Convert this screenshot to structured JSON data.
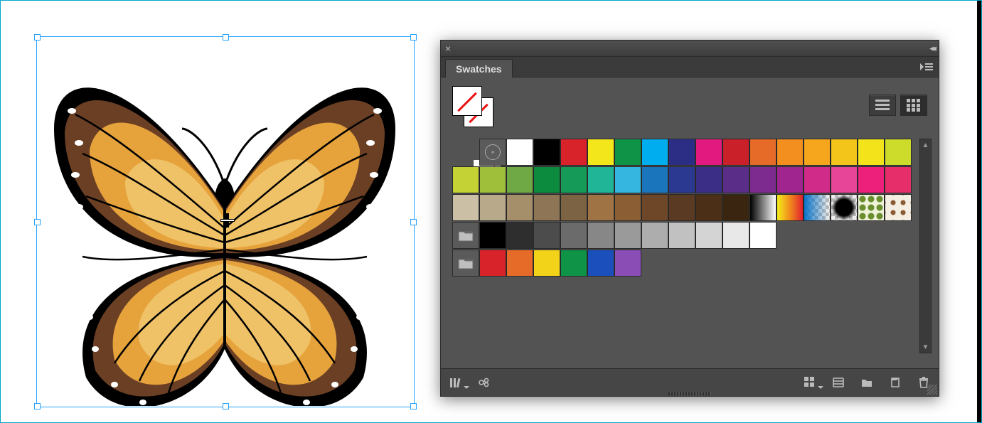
{
  "panel": {
    "tab_label": "Swatches",
    "fillstroke": {
      "fill": "none",
      "stroke": "none"
    },
    "view_buttons": {
      "list": "list-view",
      "grid": "grid-view",
      "active": "grid"
    },
    "rows": [
      {
        "type": "colors",
        "selected_index": 0,
        "cells": [
          {
            "kind": "none",
            "name": "none-swatch"
          },
          {
            "kind": "reg",
            "name": "registration-swatch"
          },
          {
            "kind": "color",
            "name": "white",
            "value": "#ffffff"
          },
          {
            "kind": "color",
            "name": "black",
            "value": "#000000"
          },
          {
            "kind": "color",
            "name": "cmyk-red",
            "value": "#d9232a"
          },
          {
            "kind": "color",
            "name": "cmyk-yellow",
            "value": "#f3e71b"
          },
          {
            "kind": "color",
            "name": "cmyk-green",
            "value": "#0f9347"
          },
          {
            "kind": "color",
            "name": "cmyk-cyan",
            "value": "#00adef"
          },
          {
            "kind": "color",
            "name": "cmyk-blue",
            "value": "#2c2e85"
          },
          {
            "kind": "color",
            "name": "cmyk-magenta",
            "value": "#e2197e"
          },
          {
            "kind": "color",
            "name": "red-2",
            "value": "#c9202a"
          },
          {
            "kind": "color",
            "name": "orange-1",
            "value": "#e76b28"
          },
          {
            "kind": "color",
            "name": "orange-2",
            "value": "#f28f1e"
          },
          {
            "kind": "color",
            "name": "amber",
            "value": "#f6a61c"
          },
          {
            "kind": "color",
            "name": "gold",
            "value": "#f3c41a"
          },
          {
            "kind": "color",
            "name": "yellow-2",
            "value": "#f2e31a"
          },
          {
            "kind": "color",
            "name": "lime-2",
            "value": "#cddc2a"
          }
        ]
      },
      {
        "type": "colors",
        "cells": [
          {
            "kind": "color",
            "name": "lime-3",
            "value": "#c4d235"
          },
          {
            "kind": "color",
            "name": "olive-1",
            "value": "#9fbf3a"
          },
          {
            "kind": "color",
            "name": "leaf",
            "value": "#6fa945"
          },
          {
            "kind": "color",
            "name": "green-2",
            "value": "#0c8b3f"
          },
          {
            "kind": "color",
            "name": "green-3",
            "value": "#169a58"
          },
          {
            "kind": "color",
            "name": "teal-1",
            "value": "#21b597"
          },
          {
            "kind": "color",
            "name": "sky-1",
            "value": "#35b6e0"
          },
          {
            "kind": "color",
            "name": "blue-2",
            "value": "#1b75bc"
          },
          {
            "kind": "color",
            "name": "blue-3",
            "value": "#2b3990"
          },
          {
            "kind": "color",
            "name": "indigo",
            "value": "#3a2e86"
          },
          {
            "kind": "color",
            "name": "violet",
            "value": "#5a2d88"
          },
          {
            "kind": "color",
            "name": "purple",
            "value": "#7d2b8e"
          },
          {
            "kind": "color",
            "name": "magenta-2",
            "value": "#a1258e"
          },
          {
            "kind": "color",
            "name": "fuchsia",
            "value": "#d12b8a"
          },
          {
            "kind": "color",
            "name": "pink",
            "value": "#e64598"
          },
          {
            "kind": "color",
            "name": "hot-pink",
            "value": "#ed207b"
          },
          {
            "kind": "color",
            "name": "rose",
            "value": "#e62e6b"
          }
        ]
      },
      {
        "type": "colors",
        "cells": [
          {
            "kind": "color",
            "name": "warm-gray-1",
            "value": "#cbbfa6"
          },
          {
            "kind": "color",
            "name": "warm-gray-2",
            "value": "#b8a98a"
          },
          {
            "kind": "color",
            "name": "tan-1",
            "value": "#a48f6a"
          },
          {
            "kind": "color",
            "name": "tan-2",
            "value": "#8d7556"
          },
          {
            "kind": "color",
            "name": "brown-1",
            "value": "#7b6344"
          },
          {
            "kind": "color",
            "name": "brown-2",
            "value": "#a07345"
          },
          {
            "kind": "color",
            "name": "brown-3",
            "value": "#8b5e34"
          },
          {
            "kind": "color",
            "name": "brown-4",
            "value": "#6d4728"
          },
          {
            "kind": "color",
            "name": "sienna",
            "value": "#5a3a22"
          },
          {
            "kind": "color",
            "name": "umber",
            "value": "#4b2f17"
          },
          {
            "kind": "color",
            "name": "choco",
            "value": "#3a2511"
          },
          {
            "kind": "grad-bw",
            "name": "white-black-gradient"
          },
          {
            "kind": "grad-warm",
            "name": "orange-yellow-gradient"
          },
          {
            "kind": "fade",
            "name": "fade-to-transparent"
          },
          {
            "kind": "trans",
            "name": "transparent-radial"
          },
          {
            "kind": "patt1",
            "name": "pattern-foliage"
          },
          {
            "kind": "patt2",
            "name": "pattern-scroll"
          }
        ]
      },
      {
        "type": "group",
        "cells": [
          {
            "kind": "folder",
            "name": "grayscale-group"
          },
          {
            "kind": "color",
            "name": "k100",
            "value": "#000000"
          },
          {
            "kind": "color",
            "name": "k90",
            "value": "#2e2e2e"
          },
          {
            "kind": "color",
            "name": "k80",
            "value": "#4c4c4c"
          },
          {
            "kind": "color",
            "name": "k70",
            "value": "#6b6b6b"
          },
          {
            "kind": "color",
            "name": "k60",
            "value": "#878787"
          },
          {
            "kind": "color",
            "name": "k50",
            "value": "#9a9a9a"
          },
          {
            "kind": "color",
            "name": "k40",
            "value": "#adadad"
          },
          {
            "kind": "color",
            "name": "k30",
            "value": "#c1c1c1"
          },
          {
            "kind": "color",
            "name": "k20",
            "value": "#d4d4d4"
          },
          {
            "kind": "color",
            "name": "k10",
            "value": "#e8e8e8"
          },
          {
            "kind": "color",
            "name": "k0",
            "value": "#ffffff"
          }
        ]
      },
      {
        "type": "group",
        "cells": [
          {
            "kind": "folder",
            "name": "brights-group"
          },
          {
            "kind": "color",
            "name": "bright-red",
            "value": "#d9232a"
          },
          {
            "kind": "color",
            "name": "bright-orange",
            "value": "#e76b28"
          },
          {
            "kind": "color",
            "name": "bright-yellow",
            "value": "#f3d31a"
          },
          {
            "kind": "color",
            "name": "bright-green",
            "value": "#0f9347"
          },
          {
            "kind": "color",
            "name": "bright-blue",
            "value": "#1b4fbc"
          },
          {
            "kind": "color",
            "name": "bright-purple",
            "value": "#8a4db5"
          }
        ]
      }
    ],
    "footer_icons": [
      "library-menu",
      "show-kinds-menu",
      "swatch-options",
      "new-color-group",
      "new-swatch",
      "delete-swatch"
    ]
  },
  "artwork": {
    "name": "butterfly",
    "selected": true
  }
}
